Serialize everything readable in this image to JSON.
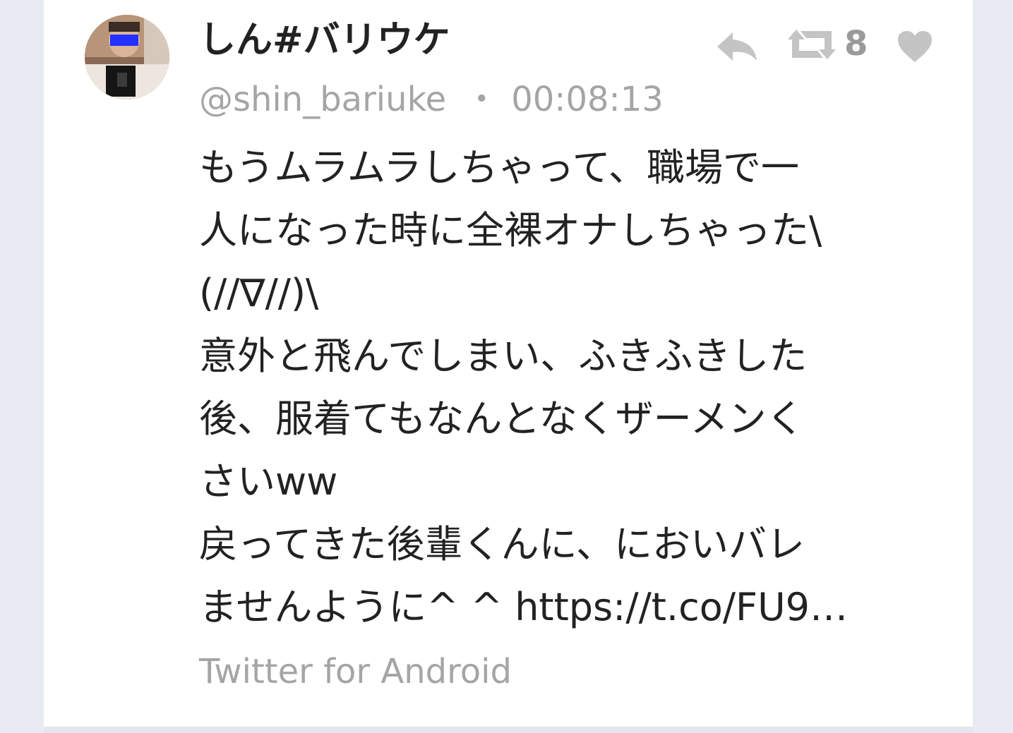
{
  "tweet": {
    "display_name": "しん#バリウケ",
    "handle": "@shin_bariuke",
    "separator": "・",
    "time": "00:08:13",
    "text": "もうムラムラしちゃって、職場で一\n人になった時に全裸オナしちゃった\\\n(//∇//)\\\n意外と飛んでしまい、ふきふきした\n後、服着てもなんとなくザーメンく\nさいww\n戻ってきた後輩くんに、においバレ\nませんように^ ^ https://t.co/FU9…",
    "source": "Twitter for Android",
    "retweet_count": "8"
  },
  "icons": {
    "reply": "reply-arrow-icon",
    "retweet": "retweet-icon",
    "like": "heart-icon",
    "avatar": "user-avatar-photo"
  },
  "colors": {
    "background": "#e8ebf1",
    "card": "#ffffff",
    "text": "#222222",
    "muted": "#a5a5a5",
    "icon": "#c4c4c4"
  }
}
